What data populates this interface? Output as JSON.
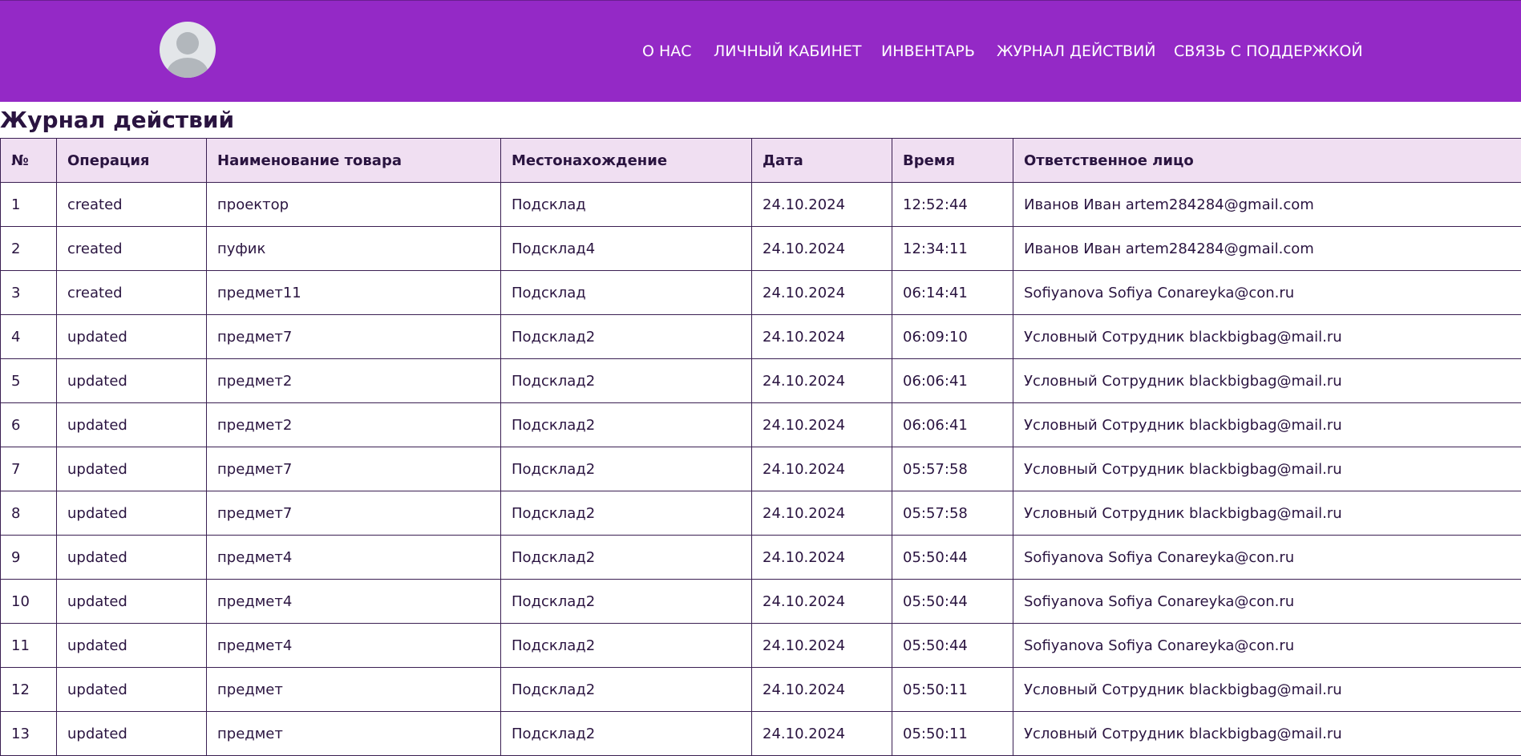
{
  "header": {
    "nav": [
      {
        "label": "О НАС"
      },
      {
        "label": "ЛИЧНЫЙ КАБИНЕТ"
      },
      {
        "label": "ИНВЕНТАРЬ"
      },
      {
        "label": "ЖУРНАЛ ДЕЙСТВИЙ"
      },
      {
        "label": "СВЯЗЬ С ПОДДЕРЖКОЙ"
      }
    ],
    "avatar_icon": "user-avatar-icon",
    "background_color": "#9429c6"
  },
  "page_title": "Журнал действий",
  "table": {
    "header_bg": "#f0dff2",
    "columns": [
      "№",
      "Операция",
      "Наименование товара",
      "Местонахождение",
      "Дата",
      "Время",
      "Ответственное лицо"
    ],
    "rows": [
      [
        "1",
        "created",
        "проектор",
        "Подсклад",
        "24.10.2024",
        "12:52:44",
        "Иванов Иван artem284284@gmail.com"
      ],
      [
        "2",
        "created",
        "пуфик",
        "Подсклад4",
        "24.10.2024",
        "12:34:11",
        "Иванов Иван artem284284@gmail.com"
      ],
      [
        "3",
        "created",
        "предмет11",
        "Подсклад",
        "24.10.2024",
        "06:14:41",
        "Sofiyanova Sofiya Conareyka@con.ru"
      ],
      [
        "4",
        "updated",
        "предмет7",
        "Подсклад2",
        "24.10.2024",
        "06:09:10",
        "Условный Сотрудник blackbigbag@mail.ru"
      ],
      [
        "5",
        "updated",
        "предмет2",
        "Подсклад2",
        "24.10.2024",
        "06:06:41",
        "Условный Сотрудник blackbigbag@mail.ru"
      ],
      [
        "6",
        "updated",
        "предмет2",
        "Подсклад2",
        "24.10.2024",
        "06:06:41",
        "Условный Сотрудник blackbigbag@mail.ru"
      ],
      [
        "7",
        "updated",
        "предмет7",
        "Подсклад2",
        "24.10.2024",
        "05:57:58",
        "Условный Сотрудник blackbigbag@mail.ru"
      ],
      [
        "8",
        "updated",
        "предмет7",
        "Подсклад2",
        "24.10.2024",
        "05:57:58",
        "Условный Сотрудник blackbigbag@mail.ru"
      ],
      [
        "9",
        "updated",
        "предмет4",
        "Подсклад2",
        "24.10.2024",
        "05:50:44",
        "Sofiyanova Sofiya Conareyka@con.ru"
      ],
      [
        "10",
        "updated",
        "предмет4",
        "Подсклад2",
        "24.10.2024",
        "05:50:44",
        "Sofiyanova Sofiya Conareyka@con.ru"
      ],
      [
        "11",
        "updated",
        "предмет4",
        "Подсклад2",
        "24.10.2024",
        "05:50:44",
        "Sofiyanova Sofiya Conareyka@con.ru"
      ],
      [
        "12",
        "updated",
        "предмет",
        "Подсклад2",
        "24.10.2024",
        "05:50:11",
        "Условный Сотрудник blackbigbag@mail.ru"
      ],
      [
        "13",
        "updated",
        "предмет",
        "Подсклад2",
        "24.10.2024",
        "05:50:11",
        "Условный Сотрудник blackbigbag@mail.ru"
      ]
    ]
  }
}
